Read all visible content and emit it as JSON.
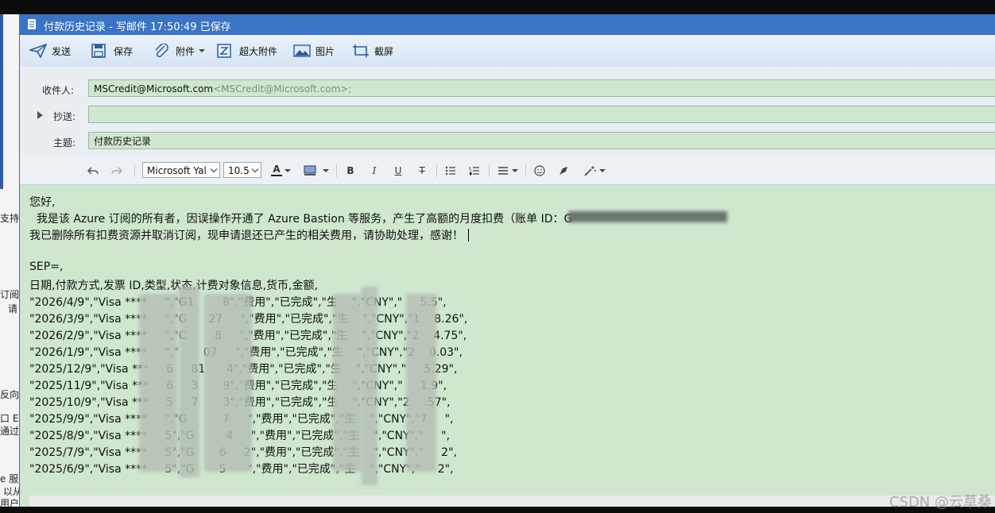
{
  "window": {
    "title": "付款历史记录 - 写邮件    17:50:49 已保存"
  },
  "toolbar": {
    "send": "发送",
    "save": "保存",
    "attach": "附件",
    "big_attach": "超大附件",
    "image": "图片",
    "screenshot": "截屏"
  },
  "header": {
    "to_label": "收件人:",
    "to_value": "MSCredit@Microsoft.com",
    "to_sub": "<MSCredit@Microsoft.com>;",
    "cc_label": "抄送:",
    "cc_value": "",
    "subject_label": "主题:",
    "subject_value": "付款历史记录"
  },
  "format": {
    "font": "Microsoft Yal",
    "size": "10.5"
  },
  "body": {
    "lines": [
      "您好,",
      "  我是该 Azure 订阅的所有者，因误操作开通了 Azure Bastion 等服务，产生了高额的月度扣费（账单 ID：G",
      "我已删除所有扣费资源并取消订阅，现申请退还已产生的相关费用，请协助处理，感谢！",
      "",
      "SEP=,",
      "日期,付款方式,发票 ID,类型,状态,计费对象信息,货币,金额,",
      "\"2026/4/9\",\"Visa ****     \",\"G1        8\",\"费用\",\"已完成\",\"生    \",\"CNY\",\"     5.5\",",
      "\"2026/3/9\",\"Visa ****     \",\"G      27     \",\"费用\",\"已完成\",\"生    \",\"CNY\",\"1    8.26\",",
      "\"2026/2/9\",\"Visa ****     \",\"C        8     \",\"费用\",\"已完成\",\"生    \",\"CNY\",\"2    4.75\",",
      "\"2026/1/9\",\"Visa ****     \",\"       07     \",\"费用\",\"已完成\",\"生    \",\"CNY\",\"2    0.03\",",
      "\"2025/12/9\",\"Visa ***     6     81      4\",\"费用\",\"已完成\",\"生    \",\"CNY\",\"     5.29\",",
      "\"2025/11/9\",\"Visa ***     6     3       9\",\"费用\",\"已完成\",\"生    \",\"CNY\",\"     1.9\",",
      "\"2025/10/9\",\"Visa ***     5     7       3\",\"费用\",\"已完成\",\"生    \",\"CNY\",\"2    .57\",",
      "\"2025/9/9\",\"Visa ****     \",\"G          7     \",\"费用\",\"已完成\",\"生    \",\"CNY\",\"7     \",",
      "\"2025/8/9\",\"Visa ****     5\",\"G         4     \",\"费用\",\"已完成\",\"生    \",\"CNY\",\"     \",",
      "\"2025/7/9\",\"Visa ****     5\",\"G       6     2\",\"费用\",\"已完成\",\"生    \",\"CNY\",\"     2\",",
      "\"2025/6/9\",\"Visa ****     5\",\"G       5      \",\"费用\",\"已完成\",\"生    \",\"CNY\",\"     2\","
    ]
  },
  "background_fragments": [
    "支持",
    "订阅",
    "请",
    "反向",
    "口 E",
    "通过",
    "e 服",
    "以从",
    "用户"
  ],
  "watermark": "CSDN @云草桑"
}
